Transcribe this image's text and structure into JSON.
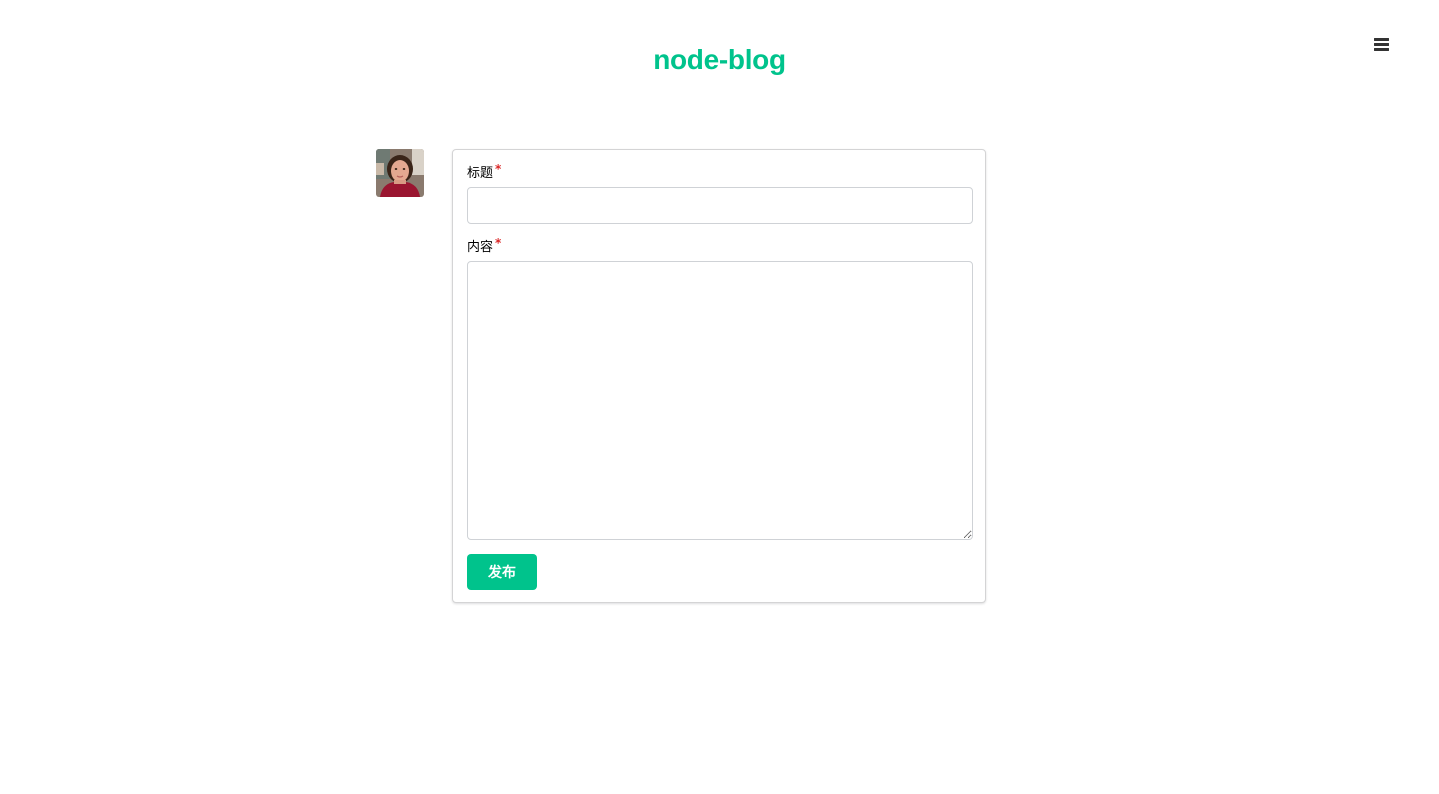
{
  "header": {
    "site_title": "node-blog",
    "menu_icon": "hamburger-menu-icon"
  },
  "sidebar": {
    "avatar_icon": "user-avatar"
  },
  "post_form": {
    "title_label": "标题",
    "title_required_mark": "*",
    "title_value": "",
    "title_placeholder": "",
    "content_label": "内容",
    "content_required_mark": "*",
    "content_value": "",
    "content_placeholder": "",
    "submit_label": "发布"
  },
  "colors": {
    "brand": "#00c38c",
    "required": "#db2828",
    "menu_icon": "#333333",
    "card_border": "#d4d4d5"
  }
}
